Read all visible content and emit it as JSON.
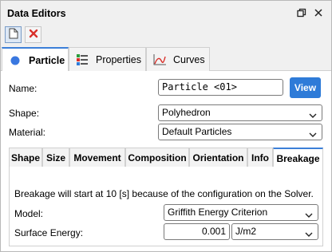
{
  "window": {
    "title": "Data Editors",
    "restore_icon": "restore-icon",
    "close_icon": "close-icon"
  },
  "toolbar": {
    "new_icon": "new-document-icon",
    "delete_icon": "delete-icon"
  },
  "main_tabs": [
    {
      "label": "Particle",
      "icon": "particle-dot-icon",
      "active": true
    },
    {
      "label": "Properties",
      "icon": "properties-grid-icon",
      "active": false
    },
    {
      "label": "Curves",
      "icon": "curves-chart-icon",
      "active": false
    }
  ],
  "form": {
    "name_label": "Name:",
    "name_value": "Particle <01>",
    "view_button": "View",
    "shape_label": "Shape:",
    "shape_value": "Polyhedron",
    "material_label": "Material:",
    "material_value": "Default Particles"
  },
  "sub_tabs": [
    {
      "label": "Shape"
    },
    {
      "label": "Size"
    },
    {
      "label": "Movement"
    },
    {
      "label": "Composition"
    },
    {
      "label": "Orientation"
    },
    {
      "label": "Info"
    },
    {
      "label": "Breakage",
      "active": true
    }
  ],
  "breakage": {
    "message": "Breakage will start at 10 [s] because of the configuration on the Solver.",
    "model_label": "Model:",
    "model_value": "Griffith Energy Criterion",
    "surface_energy_label": "Surface Energy:",
    "surface_energy_value": "0.001",
    "surface_energy_unit": "J/m2"
  },
  "colors": {
    "accent": "#2e7bd8",
    "tab_highlight": "#3c7fd8",
    "delete_red": "#d9302a"
  }
}
